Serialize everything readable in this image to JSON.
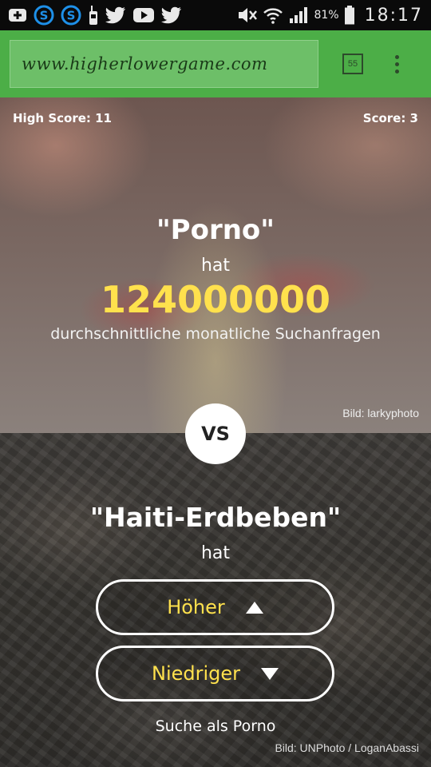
{
  "status_bar": {
    "battery_percent": "81",
    "percent_sign": "%",
    "time": "18:17",
    "icons": [
      "plus-box-icon",
      "skype-icon",
      "skype-icon",
      "walkie-icon",
      "twitter-icon",
      "youtube-icon",
      "twitter-icon",
      "mute-icon",
      "wifi-icon",
      "signal-icon",
      "battery-icon"
    ]
  },
  "browser": {
    "url": "www.higherlowergame.com",
    "tab_count": "55"
  },
  "game": {
    "high_score_label": "High Score: 11",
    "score_label": "Score: 3",
    "top": {
      "name": "\"Porno\"",
      "has": "hat",
      "number": "124000000",
      "description": "durchschnittliche monatliche Suchanfragen",
      "credit": "Bild: larkyphoto"
    },
    "vs": "VS",
    "bottom": {
      "name": "\"Haiti-Erdbeben\"",
      "has": "hat",
      "higher_label": "Höher",
      "lower_label": "Niedriger",
      "search_as": "Suche als Porno",
      "credit": "Bild: UNPhoto / LoganAbassi"
    }
  },
  "colors": {
    "browser_green": "#4cae47",
    "highlight_yellow": "#ffe14d"
  }
}
